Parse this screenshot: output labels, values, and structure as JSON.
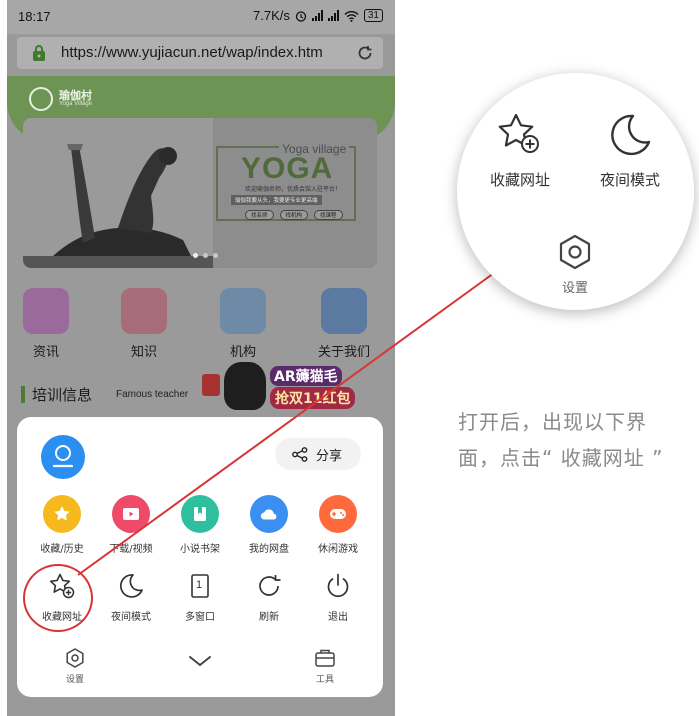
{
  "status_bar": {
    "time": "18:17",
    "speed": "7.7K/s",
    "battery": "31"
  },
  "browser": {
    "url": "https://www.yujiacun.net/wap/index.htm"
  },
  "site": {
    "logo_name": "瑜伽村",
    "logo_sub": "Yoga Village",
    "hero": {
      "script_title": "Yoga village",
      "title": "YOGA",
      "subtitle": "欢迎瑜伽名师，优质会馆入驻平台！",
      "tagline": "瑜伽我要从头，我要更专业更高端",
      "pills": [
        "找名师",
        "找机构",
        "找课程"
      ]
    },
    "categories": [
      {
        "label": "资讯",
        "icon": "news-icon",
        "color": "#9a6a9c"
      },
      {
        "label": "知识",
        "icon": "book-icon",
        "color": "#a86d7b"
      },
      {
        "label": "机构",
        "icon": "building-icon",
        "color": "#6f8aa6"
      },
      {
        "label": "关于我们",
        "icon": "person-icon",
        "color": "#5a7aa2"
      }
    ],
    "section_title": "培训信息",
    "section_en": "Famous teacher",
    "promo": {
      "line1": "AR薅猫毛",
      "line2": "抢双11红包"
    }
  },
  "menu": {
    "share_label": "分享",
    "quick_actions": [
      {
        "label": "收藏/历史",
        "icon": "star-icon",
        "color": "#f5b81d"
      },
      {
        "label": "下载/视频",
        "icon": "video-icon",
        "color": "#f04a6a"
      },
      {
        "label": "小说书架",
        "icon": "bookshelf-icon",
        "color": "#2fbf9f"
      },
      {
        "label": "我的网盘",
        "icon": "cloud-icon",
        "color": "#3a8ff0"
      },
      {
        "label": "休闲游戏",
        "icon": "gamepad-icon",
        "color": "#ff6a3c"
      }
    ],
    "tools": [
      {
        "label": "收藏网址",
        "icon": "star-plus-icon"
      },
      {
        "label": "夜间模式",
        "icon": "moon-icon"
      },
      {
        "label": "多窗口",
        "icon": "windows-icon",
        "count": "1"
      },
      {
        "label": "刷新",
        "icon": "refresh-icon"
      },
      {
        "label": "退出",
        "icon": "power-icon"
      }
    ],
    "bottom": {
      "settings_label": "设置",
      "tools_label": "工具"
    }
  },
  "zoom": {
    "bookmark_label": "收藏网址",
    "night_label": "夜间模式",
    "settings_label": "设置"
  },
  "instruction": "打开后，出现以下界面，点击“ 收藏网址 ”",
  "colors": {
    "highlight": "#d93434",
    "accent_blue": "#2a8ff0",
    "site_green": "#6e9455"
  }
}
